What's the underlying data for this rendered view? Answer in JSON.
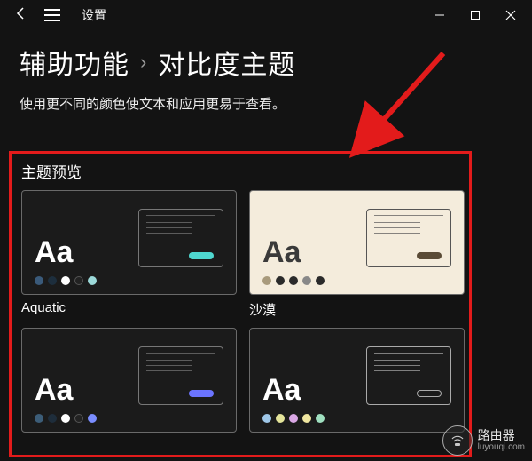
{
  "titlebar": {
    "app_name": "设置"
  },
  "breadcrumb": {
    "parent": "辅助功能",
    "current": "对比度主题"
  },
  "subtitle": "使用更不同的颜色使文本和应用更易于查看。",
  "section": {
    "preview_label": "主题预览"
  },
  "themes": [
    {
      "name": "Aquatic",
      "Aa": "Aa"
    },
    {
      "name": "沙漠",
      "Aa": "Aa"
    },
    {
      "name": "",
      "Aa": "Aa"
    },
    {
      "name": "",
      "Aa": "Aa"
    }
  ],
  "watermark": {
    "name": "路由器",
    "domain": "luyouqi.com"
  }
}
